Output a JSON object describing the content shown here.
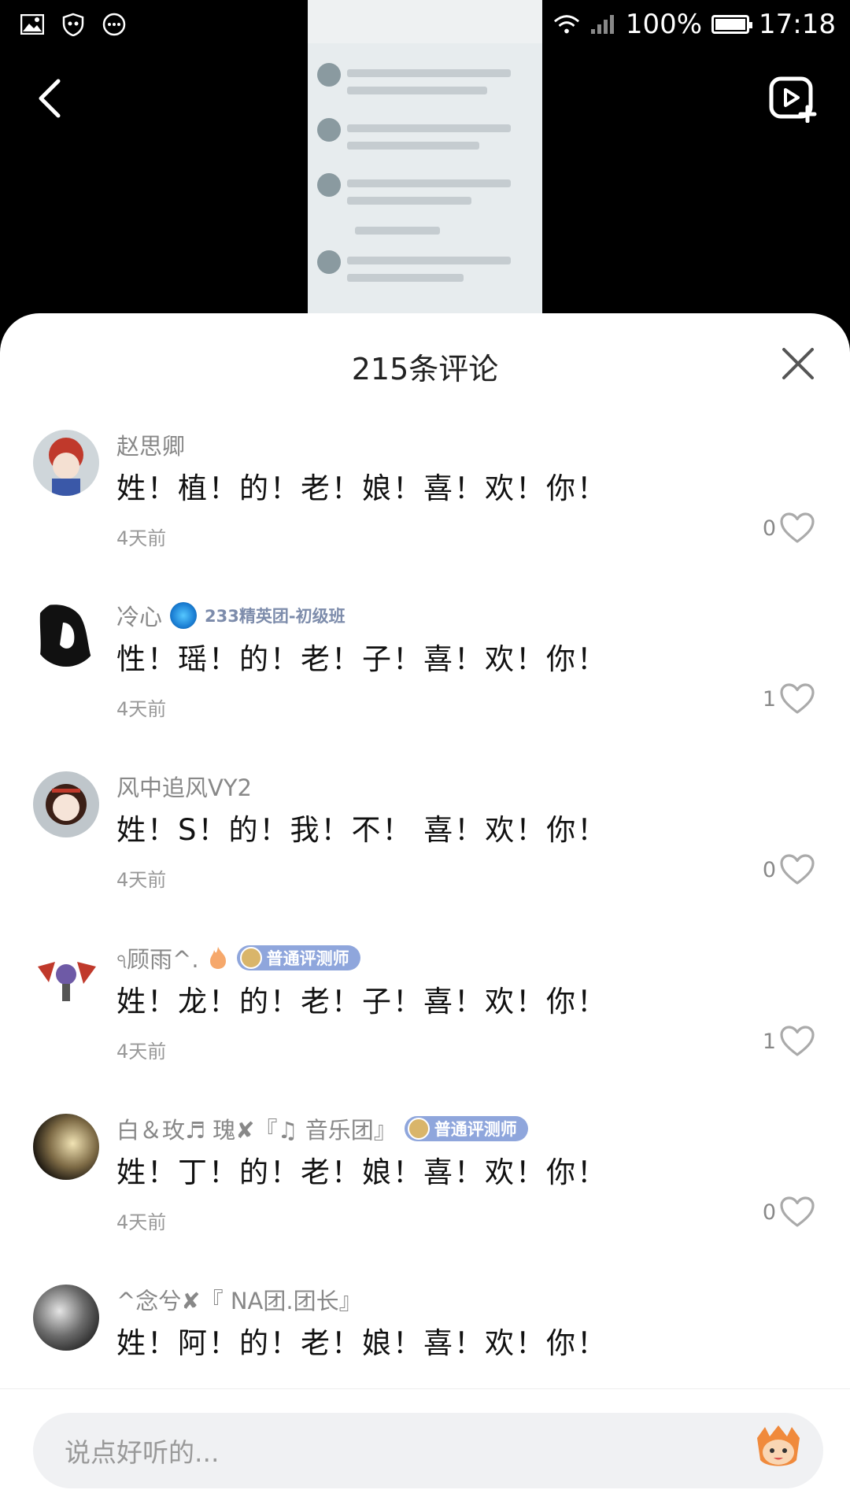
{
  "status_bar": {
    "battery": "100%",
    "time": "17:18"
  },
  "sheet": {
    "title": "215条评论"
  },
  "comments": [
    {
      "name": "赵思卿",
      "text": "姓！植！的！老！娘！喜！欢！你！",
      "time": "4天前",
      "likes": "0"
    },
    {
      "name": "冷心",
      "tag": "233精英团-初级班",
      "text": "性！瑶！的！老！子！喜！欢！你！",
      "time": "4天前",
      "likes": "1"
    },
    {
      "name": "风中追风VY2",
      "text": "姓！S！的！我！不！ 喜！欢！你！",
      "time": "4天前",
      "likes": "0"
    },
    {
      "name": "ঀ顾雨^.",
      "badge": "普通评测师",
      "text": "姓！龙！的！老！子！喜！欢！你！",
      "time": "4天前",
      "likes": "1"
    },
    {
      "name": "白＆玫♬ 瑰✘『♫ 音乐团』",
      "badge": "普通评测师",
      "text": "姓！丁！的！老！娘！喜！欢！你！",
      "time": "4天前",
      "likes": "0"
    },
    {
      "name": "^念兮✘『 NA团.团长』",
      "text": "姓！阿！的！老！娘！喜！欢！你！"
    }
  ],
  "input": {
    "placeholder": "说点好听的..."
  }
}
